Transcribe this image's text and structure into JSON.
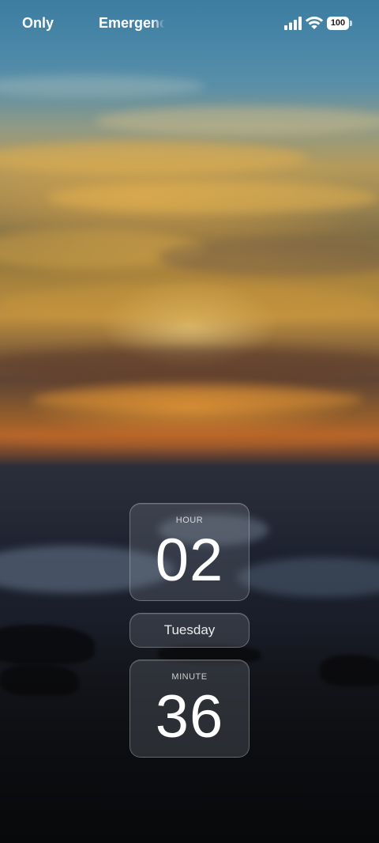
{
  "status_bar": {
    "carrier_left": "Only",
    "carrier_right": "Emergency",
    "battery_level": "100",
    "signal_icon": "cellular-signal-icon",
    "wifi_icon": "wifi-icon"
  },
  "clock_widget": {
    "hour_label": "HOUR",
    "hour_value": "02",
    "day": "Tuesday",
    "minute_label": "MINUTE",
    "minute_value": "36"
  },
  "wallpaper": {
    "description_colors": [
      "#3c7da0",
      "#c09040",
      "#b0662a",
      "#1a1e2a"
    ]
  }
}
